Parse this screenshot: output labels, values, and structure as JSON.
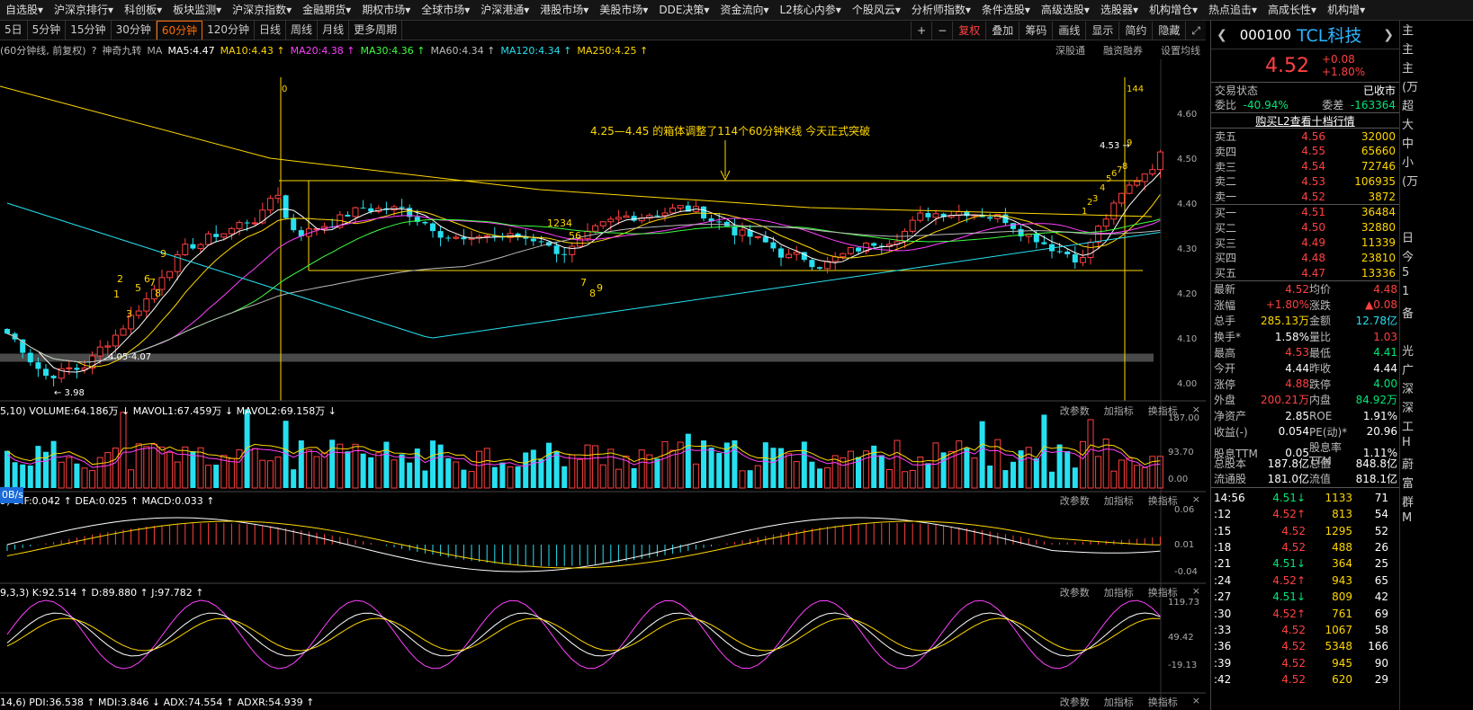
{
  "menu": [
    "自选股",
    "沪深京排行",
    "科创板",
    "板块监测",
    "沪深京指数",
    "金融期货",
    "期权市场",
    "全球市场",
    "沪深港通",
    "港股市场",
    "美股市场",
    "DDE决策",
    "资金流向",
    "L2核心内参",
    "个股风云",
    "分析师指数",
    "条件选股",
    "高级选股",
    "选股器",
    "机构增仓",
    "热点追击",
    "高成长性",
    "机构增"
  ],
  "periods": [
    "5日",
    "5分钟",
    "15分钟",
    "30分钟",
    "60分钟",
    "120分钟",
    "日线",
    "周线",
    "月线",
    "更多周期"
  ],
  "active_period": "60分钟",
  "toolbar_right": [
    "+",
    "−",
    "复权",
    "叠加",
    "筹码",
    "画线",
    "显示",
    "简约",
    "隐藏"
  ],
  "ma_bar": {
    "prefix": "(60分钟线, 前复权)",
    "tool": "神奇九转",
    "items": [
      {
        "t": "MA",
        "c": "#aaaaaa"
      },
      {
        "t": "MA5:4.47",
        "c": "#ffffff"
      },
      {
        "t": "MA10:4.43 ↑",
        "c": "#ffd700"
      },
      {
        "t": "MA20:4.38 ↑",
        "c": "#ff40ff"
      },
      {
        "t": "MA30:4.36 ↑",
        "c": "#40ff40"
      },
      {
        "t": "MA60:4.34 ↑",
        "c": "#bbbbbb"
      },
      {
        "t": "MA120:4.34 ↑",
        "c": "#26e0f0"
      },
      {
        "t": "MA250:4.25 ↑",
        "c": "#ffd700"
      }
    ],
    "right": [
      "深股通",
      "融资融券",
      "设置均线"
    ]
  },
  "chart_data": {
    "type": "candlestick",
    "price_axis": [
      "4.60",
      "4.50",
      "4.40",
      "4.30",
      "4.20",
      "4.10",
      "4.00"
    ],
    "box_high": 4.45,
    "box_low": 4.25,
    "annotation": "4.25—4.45 的箱体调整了114个60分钟K线 今天正式突破",
    "marker_start": "0",
    "marker_end": "144",
    "label_high": "4.53",
    "label_low": "3.98",
    "label_mid": "4.05-4.07",
    "seq_top_left": [
      "1",
      "2",
      "3",
      "5",
      "6",
      "7",
      "8",
      "9"
    ],
    "seq_top_mid": "1234",
    "seq_top_mid2": "56",
    "seq_bot": [
      "7",
      "8",
      "9"
    ],
    "seq_top_right": [
      "1",
      "2",
      "3",
      "4",
      "5",
      "6",
      "7",
      "8",
      "9"
    ]
  },
  "vol": {
    "head": "5,10) VOLUME:64.186万 ↓  MAVOL1:67.459万 ↓  MAVOL2:69.158万 ↓",
    "axis": [
      "187.00",
      "93.70",
      "0.00"
    ]
  },
  "macd": {
    "head": "9) DIF:0.042 ↑ DEA:0.025 ↑ MACD:0.033 ↑",
    "axis": [
      "0.06",
      "0.01",
      "-0.04"
    ]
  },
  "kdj": {
    "head": "9,3,3) K:92.514 ↑ D:89.880 ↑ J:97.782 ↑",
    "axis": [
      "119.73",
      "49.42",
      "-19.13"
    ]
  },
  "dmi": {
    "head": "14,6) PDI:36.538 ↑ MDI:3.846 ↓ ADX:74.554 ↑ ADXR:54.939 ↑"
  },
  "indicator_tools": [
    "改参数",
    "加指标",
    "换指标",
    "×"
  ],
  "speed_badge": "0B/s",
  "stock": {
    "code": "000100",
    "name": "TCL科技",
    "price": "4.52",
    "change": "+0.08",
    "pct": "+1.80%"
  },
  "status": {
    "label": "交易状态",
    "value": "已收市",
    "wb_label": "委比",
    "wb": "-40.94%",
    "wc_label": "委差",
    "wc": "-163364"
  },
  "l2link": "购买L2查看十档行情",
  "asks": [
    {
      "l": "卖五",
      "p": "4.56",
      "v": "32000"
    },
    {
      "l": "卖四",
      "p": "4.55",
      "v": "65660"
    },
    {
      "l": "卖三",
      "p": "4.54",
      "v": "72746"
    },
    {
      "l": "卖二",
      "p": "4.53",
      "v": "106935"
    },
    {
      "l": "卖一",
      "p": "4.52",
      "v": "3872"
    }
  ],
  "bids": [
    {
      "l": "买一",
      "p": "4.51",
      "v": "36484"
    },
    {
      "l": "买二",
      "p": "4.50",
      "v": "32880"
    },
    {
      "l": "买三",
      "p": "4.49",
      "v": "11339"
    },
    {
      "l": "买四",
      "p": "4.48",
      "v": "23810"
    },
    {
      "l": "买五",
      "p": "4.47",
      "v": "13336"
    }
  ],
  "quotes": [
    [
      "最新",
      "4.52",
      "均价",
      "4.48",
      "red",
      "red"
    ],
    [
      "涨幅",
      "+1.80%",
      "涨跌",
      "▲0.08",
      "red",
      "red"
    ],
    [
      "总手",
      "285.13万",
      "金额",
      "12.78亿",
      "yellow",
      "cyan"
    ],
    [
      "换手*",
      "1.58%",
      "量比",
      "1.03",
      "white",
      "red"
    ],
    [
      "最高",
      "4.53",
      "最低",
      "4.41",
      "red",
      "green"
    ],
    [
      "今开",
      "4.44",
      "昨收",
      "4.44",
      "white",
      "white"
    ],
    [
      "涨停",
      "4.88",
      "跌停",
      "4.00",
      "red",
      "green"
    ],
    [
      "外盘",
      "200.21万",
      "内盘",
      "84.92万",
      "red",
      "green"
    ],
    [
      "净资产",
      "2.85",
      "ROE",
      "1.91%",
      "white",
      "white"
    ],
    [
      "收益(-)",
      "0.054",
      "PE(动)*",
      "20.96",
      "white",
      "white"
    ],
    [
      "股息TTM",
      "0.05",
      "股息率TTM",
      "1.11%",
      "white",
      "white"
    ],
    [
      "总股本",
      "187.8亿",
      "总值",
      "848.8亿",
      "white",
      "white"
    ],
    [
      "流通股",
      "181.0亿",
      "流值",
      "818.1亿",
      "white",
      "white"
    ]
  ],
  "ticks": [
    [
      "14:56",
      "4.51↓",
      "1133",
      "71",
      "green"
    ],
    [
      ":12",
      "4.52↑",
      "813",
      "54",
      "red"
    ],
    [
      ":15",
      "4.52",
      "1295",
      "52",
      "red"
    ],
    [
      ":18",
      "4.52",
      "488",
      "26",
      "red"
    ],
    [
      ":21",
      "4.51↓",
      "364",
      "25",
      "green"
    ],
    [
      ":24",
      "4.52↑",
      "943",
      "65",
      "red"
    ],
    [
      ":27",
      "4.51↓",
      "809",
      "42",
      "green"
    ],
    [
      ":30",
      "4.52↑",
      "761",
      "69",
      "red"
    ],
    [
      ":33",
      "4.52",
      "1067",
      "58",
      "red"
    ],
    [
      ":36",
      "4.52",
      "5348",
      "166",
      "red"
    ],
    [
      ":39",
      "4.52",
      "945",
      "90",
      "red"
    ],
    [
      ":42",
      "4.52",
      "620",
      "29",
      "red"
    ]
  ],
  "edge_chars": [
    "主",
    "主",
    "主",
    "(万",
    "超",
    "大",
    "中",
    "小",
    "(万",
    "",
    "",
    "日",
    "今",
    "5",
    "1",
    "备",
    "",
    "光",
    "广",
    "深",
    "深",
    "工",
    "H",
    "蔚",
    "富",
    "群",
    "M"
  ]
}
